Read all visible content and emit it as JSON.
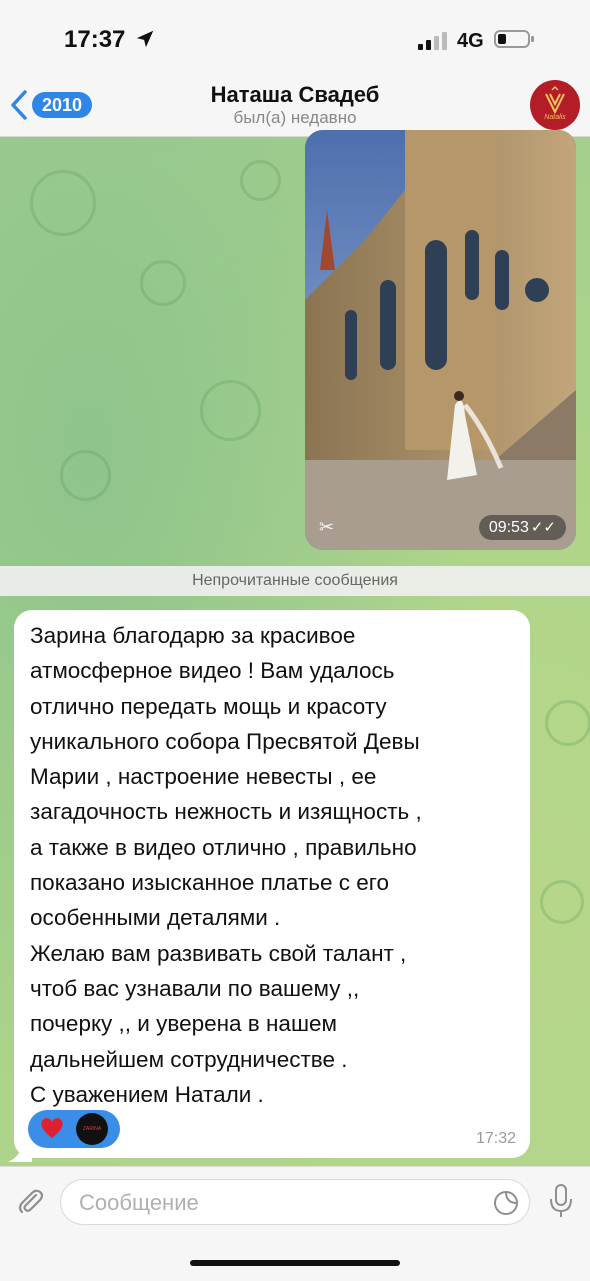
{
  "status_bar": {
    "time": "17:37",
    "network": "4G"
  },
  "header": {
    "back_count": "2010",
    "contact_name": "Наташа Свадеб",
    "status": "был(а) недавно",
    "avatar_logo_text": "Natalis"
  },
  "media_message": {
    "time": "09:53"
  },
  "unread_separator": "Непрочитанные сообщения",
  "text_message": {
    "body": "Зарина благодарю за красивое\nатмосферное видео ! Вам удалось\nотлично передать мощь и красоту\nуникального собора Пресвятой  Девы\nМарии , настроение невесты , ее\nзагадочность нежность и изящность ,\nа также в видео отлично , правильно\nпоказано изысканное платье с его\nособенными деталями .\nЖелаю вам развивать свой талант ,\nчтоб вас узнавали по вашему ,,\nпочерку ,, и уверена в нашем\nдальнейшем сотрудничестве .\nС уважением Натали .",
    "time": "17:32",
    "reaction_avatar_text": "ZARINA"
  },
  "input": {
    "placeholder": "Сообщение"
  },
  "icons": [
    "location-arrow-icon",
    "signal-icon",
    "battery-icon",
    "chevron-left-icon",
    "heart-icon",
    "paperclip-icon",
    "sticker-icon",
    "microphone-icon",
    "capcut-icon",
    "read-ticks-icon"
  ],
  "colors": {
    "accent": "#2f86e6",
    "wallpaper": "#a6cf8a",
    "reaction_bg": "#3b8ee8",
    "avatar_bg": "#b21d28"
  }
}
